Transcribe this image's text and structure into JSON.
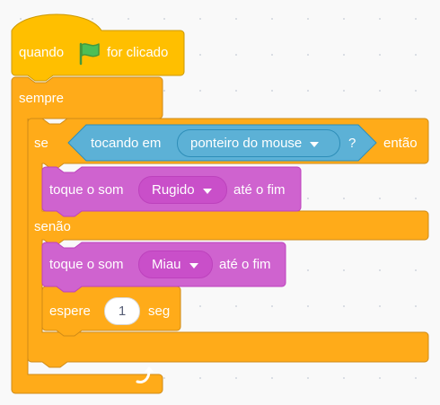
{
  "hat_block": {
    "prefix": "quando",
    "suffix": "for clicado",
    "icon": "green-flag-icon"
  },
  "forever_block": {
    "label": "sempre",
    "loop_icon": "loop-arrow-icon"
  },
  "if_else_block": {
    "if_label": "se",
    "then_label": "então",
    "else_label": "senão"
  },
  "condition_block": {
    "label": "tocando em",
    "menu_value": "ponteiro do mouse",
    "suffix": "?"
  },
  "sound_block_1": {
    "prefix": "toque o som",
    "sound": "Rugido",
    "suffix": "até o fim"
  },
  "sound_block_2": {
    "prefix": "toque o som",
    "sound": "Miau",
    "suffix": "até o fim"
  },
  "wait_block": {
    "prefix": "espere",
    "value": "1",
    "suffix": "seg"
  },
  "colors": {
    "control": "#ffab19",
    "control_border": "#cf8b17",
    "events": "#ffbf00",
    "events_border": "#cc9900",
    "sensing": "#5cb1d6",
    "sensing_border": "#2e8eb8",
    "sound": "#cf63cf",
    "sound_border": "#bd42bd",
    "sound_pill": "#c94fc9"
  }
}
